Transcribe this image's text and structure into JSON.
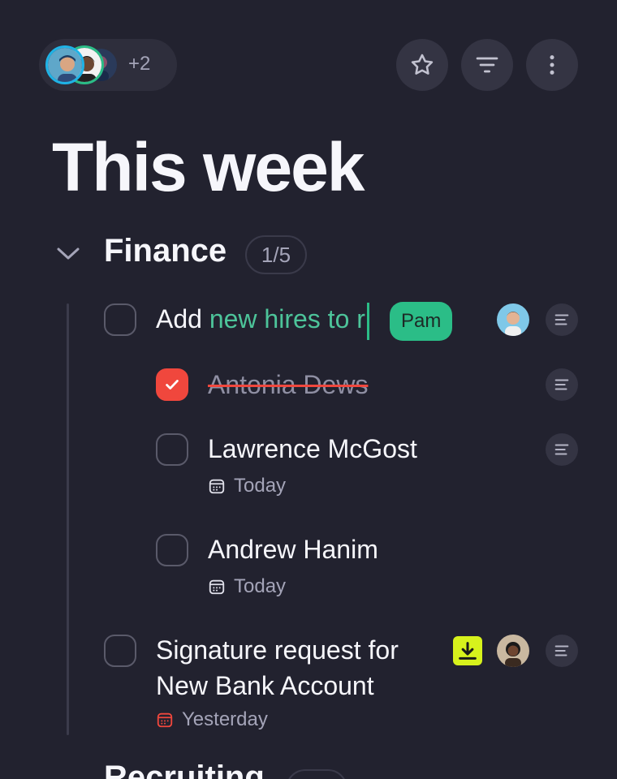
{
  "header": {
    "extra_members": "+2",
    "avatars": [
      "member-avatar-1",
      "member-avatar-2",
      "member-avatar-3"
    ]
  },
  "page": {
    "title": "This week"
  },
  "section": {
    "title": "Finance",
    "count": "1/5"
  },
  "tasks": [
    {
      "text_plain": "Add ",
      "text_highlight": "new hires to r",
      "collaborator_tag": "Pam",
      "checked": false
    },
    {
      "text": "Antonia Dews",
      "checked": true
    },
    {
      "text": "Lawrence McGost",
      "checked": false,
      "due": "Today"
    },
    {
      "text": "Andrew Hanim",
      "checked": false,
      "due": "Today"
    },
    {
      "text_line1": "Signature request for",
      "text_line2": "New Bank Account",
      "checked": false,
      "due": "Yesterday",
      "due_color": "#f0473d"
    }
  ],
  "next_section": {
    "title": "Recruiting"
  },
  "colors": {
    "background": "#22222f",
    "accent_green": "#2bbd87",
    "accent_red": "#f0473d",
    "download_yellow": "#d7f21c"
  }
}
